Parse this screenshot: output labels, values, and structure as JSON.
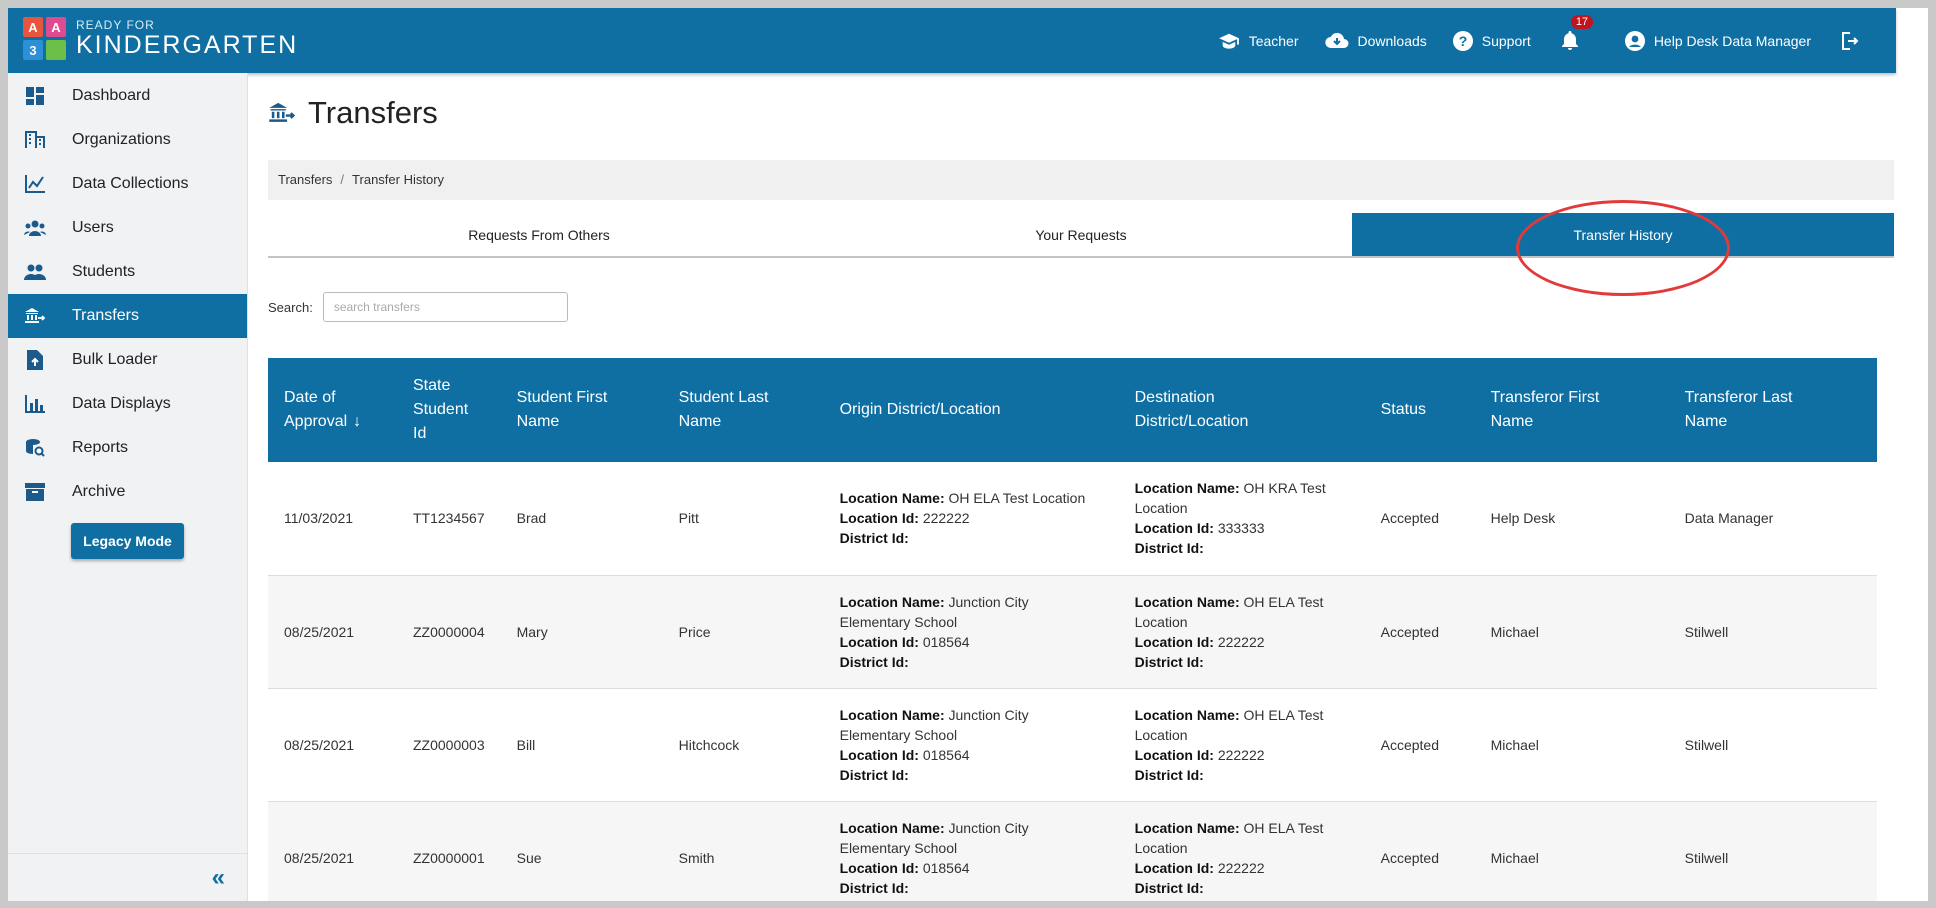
{
  "logo": {
    "line1": "READY FOR",
    "line2": "KINDERGARTEN",
    "blocks": [
      {
        "letter": "A",
        "color": "#e8543e"
      },
      {
        "letter": "A",
        "color": "#e04a8f"
      },
      {
        "letter": "3",
        "color": "#2d8fd6"
      },
      {
        "letter": "",
        "color": "#6cc04a"
      }
    ]
  },
  "topnav": {
    "teacher": "Teacher",
    "downloads": "Downloads",
    "support": "Support",
    "notifications": "17",
    "user": "Help Desk Data Manager"
  },
  "sidebar": {
    "items": [
      "Dashboard",
      "Organizations",
      "Data Collections",
      "Users",
      "Students",
      "Transfers",
      "Bulk Loader",
      "Data Displays",
      "Reports",
      "Archive"
    ],
    "legacy": "Legacy Mode",
    "collapse": "«"
  },
  "page": {
    "title": "Transfers"
  },
  "breadcrumb": {
    "root": "Transfers",
    "sep": "/",
    "current": "Transfer History"
  },
  "tabs": [
    "Requests From Others",
    "Your Requests",
    "Transfer History"
  ],
  "search": {
    "label": "Search:",
    "placeholder": "search transfers"
  },
  "table": {
    "headers": [
      [
        "Date of",
        "Approval"
      ],
      [
        "State",
        "Student",
        "Id"
      ],
      [
        "Student First",
        "Name"
      ],
      [
        "Student Last",
        "Name"
      ],
      [
        "Origin District/Location"
      ],
      [
        "Destination",
        "District/Location"
      ],
      [
        "Status"
      ],
      [
        "Transferor First",
        "Name"
      ],
      [
        "Transferor Last",
        "Name"
      ]
    ],
    "sort_arrow": "↓",
    "labels": {
      "loc_name": "Location Name:",
      "loc_id": "Location Id:",
      "district_id": "District Id:"
    },
    "rows": [
      {
        "date": "11/03/2021",
        "ssid": "TT1234567",
        "first": "Brad",
        "last": "Pitt",
        "origin_name": "OH ELA Test Location",
        "origin_id": "222222",
        "dest_name": "OH KRA Test Location",
        "dest_id": "333333",
        "status": "Accepted",
        "tfirst": "Help Desk",
        "tlast": "Data Manager"
      },
      {
        "date": "08/25/2021",
        "ssid": "ZZ0000004",
        "first": "Mary",
        "last": "Price",
        "origin_name": "Junction City Elementary School",
        "origin_id": "018564",
        "dest_name": "OH ELA Test Location",
        "dest_id": "222222",
        "status": "Accepted",
        "tfirst": "Michael",
        "tlast": "Stilwell"
      },
      {
        "date": "08/25/2021",
        "ssid": "ZZ0000003",
        "first": "Bill",
        "last": "Hitchcock",
        "origin_name": "Junction City Elementary School",
        "origin_id": "018564",
        "dest_name": "OH ELA Test Location",
        "dest_id": "222222",
        "status": "Accepted",
        "tfirst": "Michael",
        "tlast": "Stilwell"
      },
      {
        "date": "08/25/2021",
        "ssid": "ZZ0000001",
        "first": "Sue",
        "last": "Smith",
        "origin_name": "Junction City Elementary School",
        "origin_id": "018564",
        "dest_name": "OH ELA Test Location",
        "dest_id": "222222",
        "status": "Accepted",
        "tfirst": "Michael",
        "tlast": "Stilwell"
      }
    ]
  },
  "colors": {
    "primary": "#0f6fa3",
    "highlight": "#e23a3a",
    "badge": "#c0141f"
  }
}
